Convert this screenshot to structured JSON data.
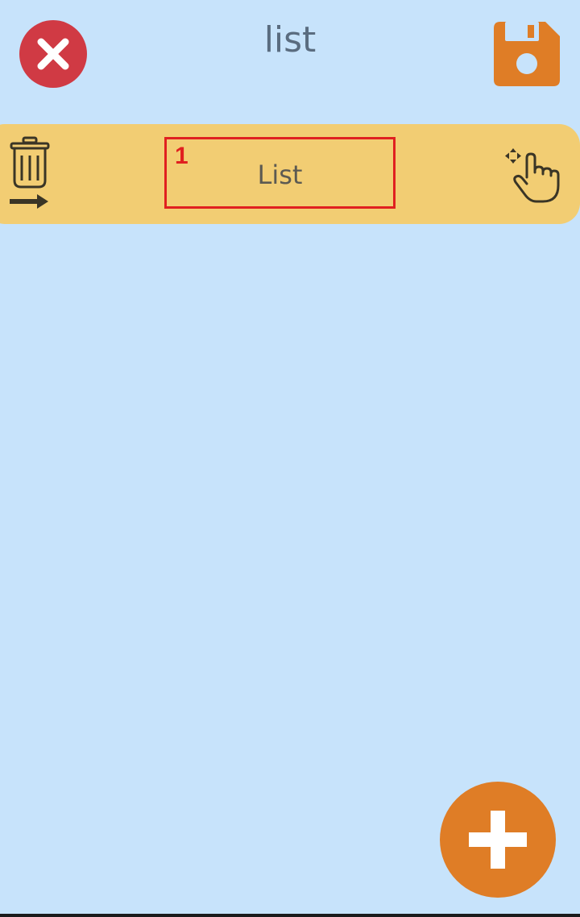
{
  "header": {
    "title": "list",
    "close_icon": "close-icon",
    "save_icon": "floppy-disk-icon"
  },
  "list": {
    "items": [
      {
        "index": "1",
        "label": "List",
        "delete_icon": "trash-arrow-icon",
        "drag_icon": "drag-hand-icon"
      }
    ]
  },
  "fab": {
    "icon": "plus-icon"
  },
  "colors": {
    "background": "#c7e3fb",
    "close_red": "#d03a44",
    "accent_orange": "#df7d26",
    "row_yellow": "#f2cd73",
    "highlight_red": "#e02020"
  }
}
